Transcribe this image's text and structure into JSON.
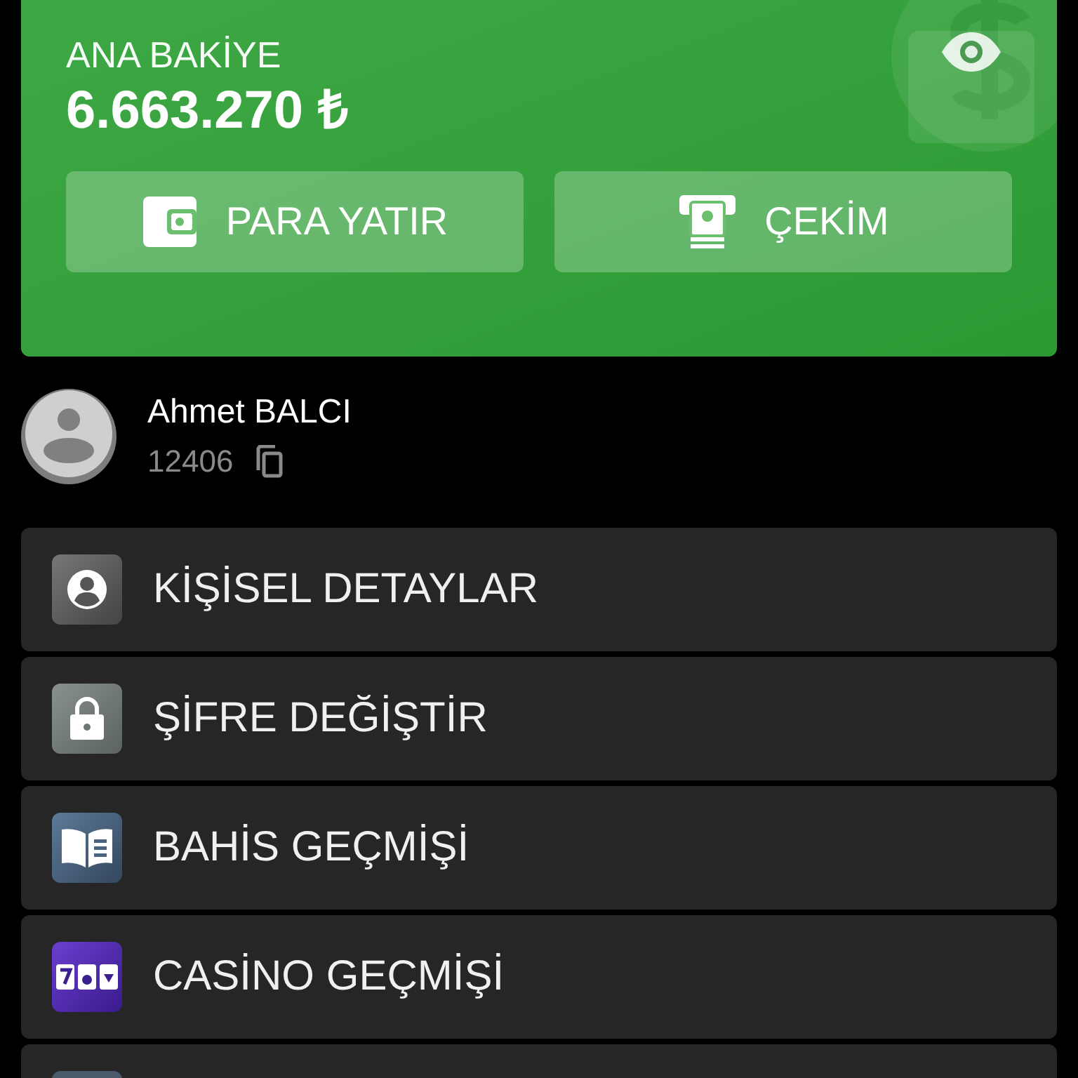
{
  "balance": {
    "label": "ANA BAKİYE",
    "amount": "6.663.270 ₺",
    "hidden": false
  },
  "actions": [
    {
      "kind": "deposit",
      "label": "PARA YATIR"
    },
    {
      "kind": "withdraw",
      "label": "ÇEKİM"
    }
  ],
  "profile": {
    "name": "Ahmet BALCI",
    "user_id": "12406"
  },
  "menu": [
    {
      "kind": "person",
      "label": "KİŞİSEL DETAYLAR"
    },
    {
      "kind": "lock",
      "label": "ŞİFRE DEĞİŞTİR"
    },
    {
      "kind": "book",
      "label": "BAHİS GEÇMİŞİ"
    },
    {
      "kind": "slots",
      "label": "CASİNO GEÇMİŞİ"
    },
    {
      "kind": "partial"
    }
  ]
}
